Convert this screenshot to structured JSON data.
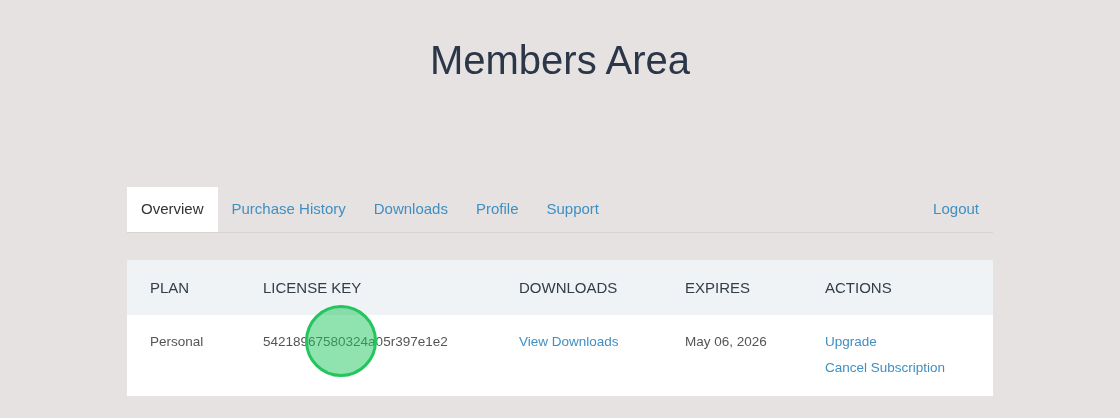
{
  "title": "Members Area",
  "tabs": [
    {
      "label": "Overview",
      "selected": true
    },
    {
      "label": "Purchase History",
      "selected": false
    },
    {
      "label": "Downloads",
      "selected": false
    },
    {
      "label": "Profile",
      "selected": false
    },
    {
      "label": "Support",
      "selected": false
    }
  ],
  "logout": "Logout",
  "table": {
    "columns": [
      "PLAN",
      "LICENSE KEY",
      "DOWNLOADS",
      "EXPIRES",
      "ACTIONS"
    ],
    "rows": [
      {
        "plan": "Personal",
        "license_key": "54218967580324a05r397e1e2",
        "downloads": "View Downloads",
        "expires": "May 06, 2026",
        "actions": [
          "Upgrade",
          "Cancel Subscription"
        ]
      }
    ]
  }
}
